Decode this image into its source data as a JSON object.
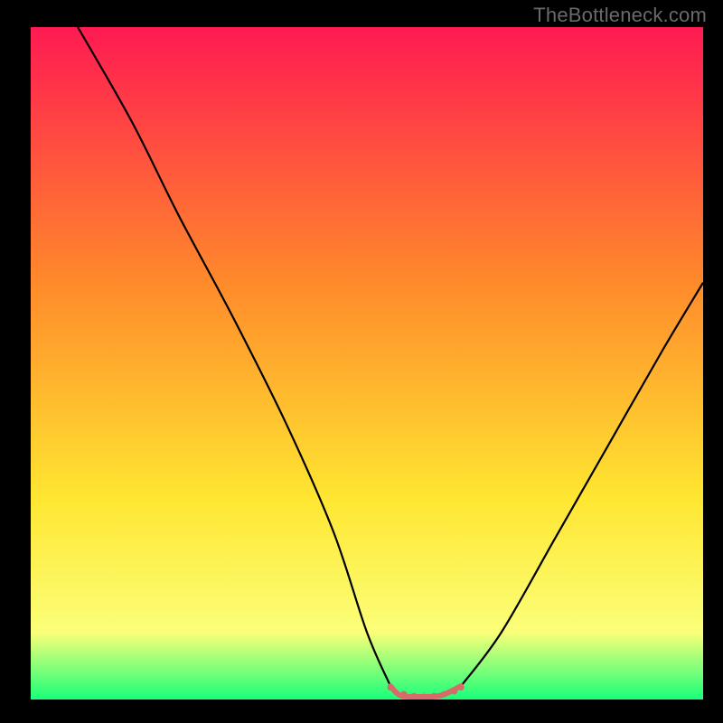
{
  "watermark": "TheBottleneck.com",
  "chart_data": {
    "type": "line",
    "title": "",
    "xlabel": "",
    "ylabel": "",
    "xlim": [
      0,
      100
    ],
    "ylim": [
      0,
      100
    ],
    "grid": false,
    "legend": false,
    "background_gradient": {
      "top": "#ff1a52",
      "mid1": "#ff8a2b",
      "mid2": "#ffe631",
      "low": "#fbff79",
      "bottom": "#19ff79"
    },
    "series": [
      {
        "name": "curve-left",
        "color": "#000000",
        "x": [
          7,
          15,
          22,
          30,
          38,
          45,
          50,
          53.5
        ],
        "y": [
          100,
          86,
          72,
          57,
          41,
          25,
          10,
          2
        ]
      },
      {
        "name": "curve-right",
        "color": "#000000",
        "x": [
          64,
          70,
          78,
          86,
          94,
          100
        ],
        "y": [
          2,
          10,
          24,
          38,
          52,
          62
        ]
      },
      {
        "name": "flat-bottom-accent",
        "color": "#d86a6a",
        "x": [
          53.5,
          55,
          58,
          61,
          64
        ],
        "y": [
          2,
          0.6,
          0.4,
          0.6,
          2
        ]
      }
    ],
    "flat_bottom_markers": {
      "color": "#d86a6a",
      "x": [
        53.5,
        55.5,
        57,
        58.5,
        60,
        61.5,
        63,
        64
      ],
      "y": [
        1.8,
        0.8,
        0.5,
        0.4,
        0.5,
        0.8,
        1.2,
        1.8
      ]
    }
  }
}
